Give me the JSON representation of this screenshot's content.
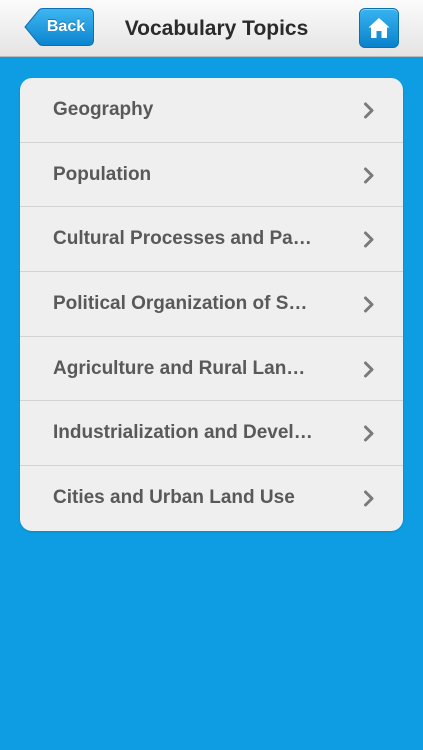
{
  "navbar": {
    "title": "Vocabulary Topics",
    "back_label": "Back",
    "home_icon": "home-icon"
  },
  "topics": [
    {
      "label": "Geography"
    },
    {
      "label": "Population"
    },
    {
      "label": "Cultural Processes and Pa…"
    },
    {
      "label": "Political Organization of S…"
    },
    {
      "label": "Agriculture and Rural Lan…"
    },
    {
      "label": "Industrialization and Devel…"
    },
    {
      "label": "Cities and Urban Land Use"
    }
  ],
  "colors": {
    "background": "#0e9de2",
    "accent": "#1a9bea",
    "list_background": "#efefef",
    "item_text": "#595959"
  }
}
